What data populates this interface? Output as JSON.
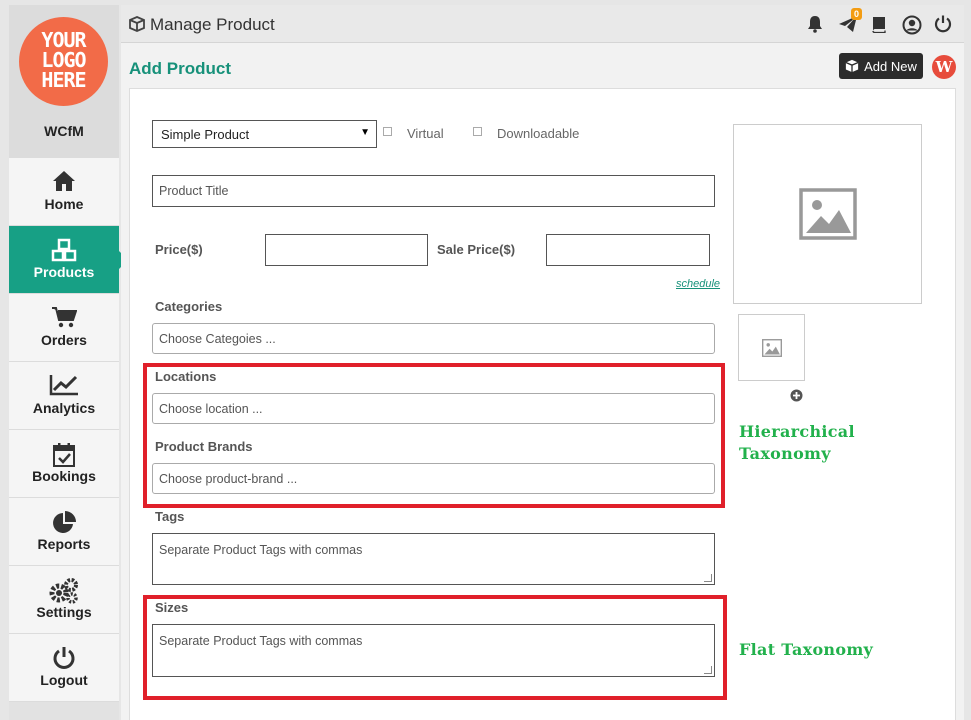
{
  "sidebar": {
    "logo_lines": [
      "YOUR",
      "LOGO",
      "HERE"
    ],
    "store_name": "WCfM",
    "items": [
      {
        "label": "Home",
        "icon": "home-icon"
      },
      {
        "label": "Products",
        "icon": "cubes-icon",
        "active": true
      },
      {
        "label": "Orders",
        "icon": "cart-icon"
      },
      {
        "label": "Analytics",
        "icon": "chart-line-icon"
      },
      {
        "label": "Bookings",
        "icon": "calendar-check-icon"
      },
      {
        "label": "Reports",
        "icon": "pie-chart-icon"
      },
      {
        "label": "Settings",
        "icon": "gears-icon"
      },
      {
        "label": "Logout",
        "icon": "power-icon"
      }
    ]
  },
  "topbar": {
    "title": "Manage Product",
    "notification_badge": "0"
  },
  "header": {
    "page_title": "Add Product",
    "add_new_label": "Add New"
  },
  "form": {
    "product_type": "Simple Product",
    "virtual_label": "Virtual",
    "downloadable_label": "Downloadable",
    "title_placeholder": "Product Title",
    "price_label": "Price($)",
    "sale_price_label": "Sale Price($)",
    "schedule_label": "schedule",
    "categories_label": "Categories",
    "categories_placeholder": "Choose Categoies ...",
    "locations_label": "Locations",
    "locations_placeholder": "Choose location ...",
    "brands_label": "Product Brands",
    "brands_placeholder": "Choose product-brand ...",
    "tags_label": "Tags",
    "tags_placeholder": "Separate Product Tags with commas",
    "sizes_label": "Sizes",
    "sizes_placeholder": "Separate Product Tags with commas"
  },
  "annotations": {
    "hierarchical_line1": "Hierarchical",
    "hierarchical_line2": "Taxonomy",
    "flat": "Flat Taxonomy"
  },
  "colors": {
    "accent": "#17a085",
    "highlight_box": "#e0202a",
    "annotation_text": "#22b14c",
    "logo": "#f26b48"
  }
}
